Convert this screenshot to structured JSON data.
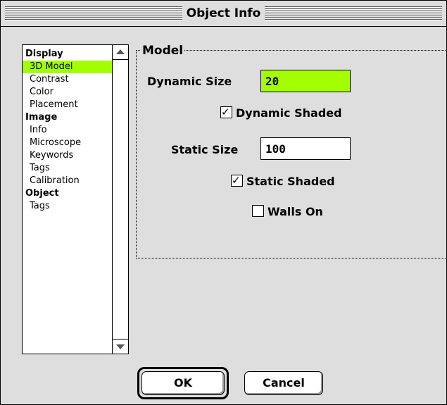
{
  "window": {
    "title": "Object Info"
  },
  "sidebar": {
    "items": [
      {
        "label": "Display",
        "type": "header"
      },
      {
        "label": "3D Model",
        "type": "item",
        "selected": true
      },
      {
        "label": "Contrast",
        "type": "item"
      },
      {
        "label": "Color",
        "type": "item"
      },
      {
        "label": "Placement",
        "type": "item"
      },
      {
        "label": "Image",
        "type": "header"
      },
      {
        "label": "Info",
        "type": "item"
      },
      {
        "label": "Microscope",
        "type": "item"
      },
      {
        "label": "Keywords",
        "type": "item"
      },
      {
        "label": "Tags",
        "type": "item"
      },
      {
        "label": "Calibration",
        "type": "item"
      },
      {
        "label": "Object",
        "type": "header"
      },
      {
        "label": "Tags",
        "type": "item"
      }
    ]
  },
  "model": {
    "group_label": "Model",
    "dynamic_size_label": "Dynamic Size",
    "dynamic_size_value": "20",
    "dynamic_shaded_label": "Dynamic Shaded",
    "dynamic_shaded_checked": true,
    "static_size_label": "Static Size",
    "static_size_value": "100",
    "static_shaded_label": "Static Shaded",
    "static_shaded_checked": true,
    "walls_on_label": "Walls On",
    "walls_on_checked": false
  },
  "buttons": {
    "ok": "OK",
    "cancel": "Cancel"
  },
  "colors": {
    "highlight": "#a3ff00",
    "window_bg": "#dedede"
  }
}
